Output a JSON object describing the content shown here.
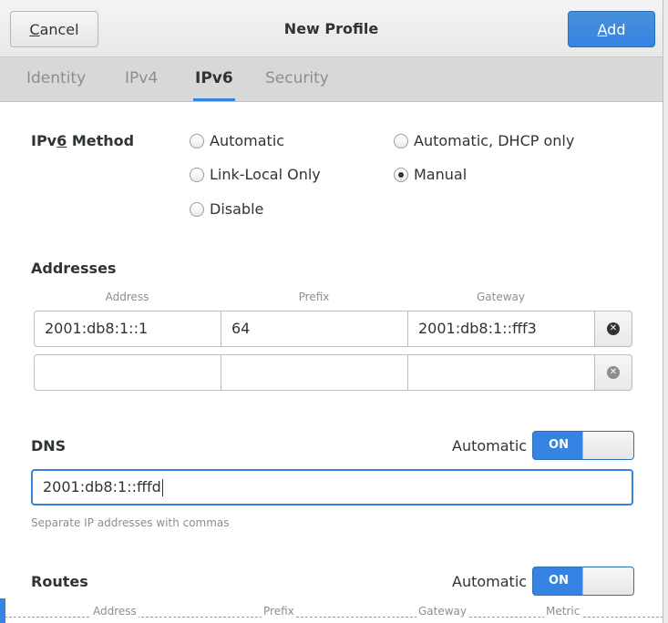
{
  "header": {
    "cancel_label": "Cancel",
    "title": "New Profile",
    "add_label": "Add"
  },
  "tabs": [
    {
      "label": "Identity",
      "active": false
    },
    {
      "label": "IPv4",
      "active": false
    },
    {
      "label": "IPv6",
      "active": true
    },
    {
      "label": "Security",
      "active": false
    }
  ],
  "method": {
    "label": "IPv6 Method",
    "options": [
      {
        "label": "Automatic",
        "checked": false
      },
      {
        "label": "Automatic, DHCP only",
        "checked": false
      },
      {
        "label": "Link-Local Only",
        "checked": false
      },
      {
        "label": "Manual",
        "checked": true
      },
      {
        "label": "Disable",
        "checked": false
      }
    ]
  },
  "addresses": {
    "label": "Addresses",
    "columns": [
      "Address",
      "Prefix",
      "Gateway"
    ],
    "rows": [
      {
        "address": "2001:db8:1::1",
        "prefix": "64",
        "gateway": "2001:db8:1::fff3"
      },
      {
        "address": "",
        "prefix": "",
        "gateway": ""
      }
    ]
  },
  "dns": {
    "label": "DNS",
    "automatic_label": "Automatic",
    "switch_label": "ON",
    "switch_on": true,
    "value": "2001:db8:1::fffd",
    "hint": "Separate IP addresses with commas"
  },
  "routes": {
    "label": "Routes",
    "automatic_label": "Automatic",
    "switch_label": "ON",
    "switch_on": true,
    "columns": [
      "Address",
      "Prefix",
      "Gateway",
      "Metric"
    ]
  },
  "colors": {
    "accent": "#3584e4",
    "text": "#2e3436",
    "dim_text": "#8b8e8f"
  }
}
